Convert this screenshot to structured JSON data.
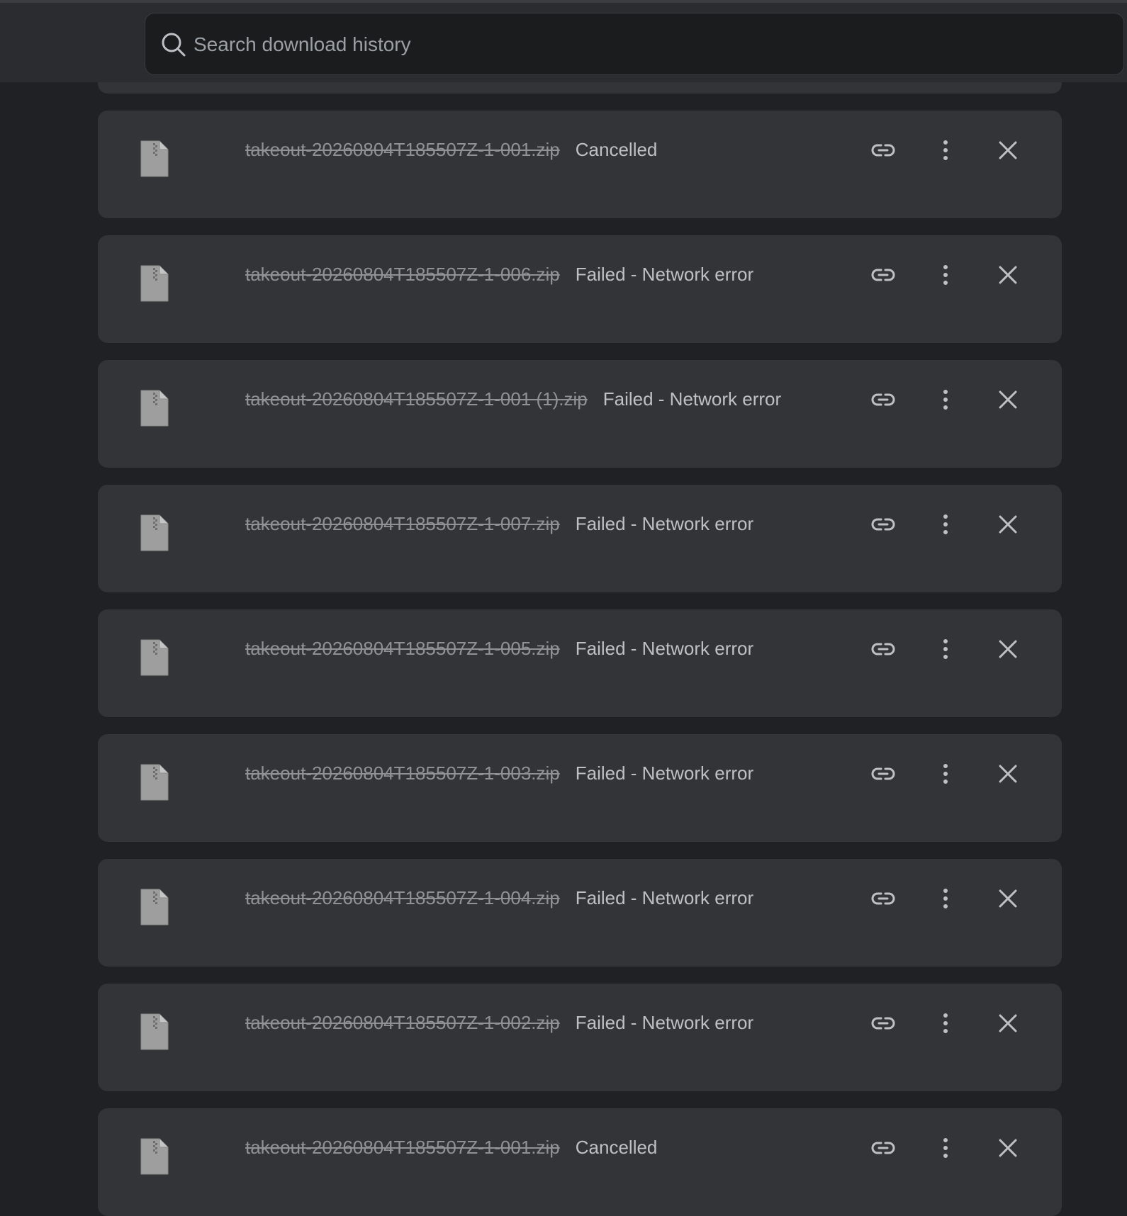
{
  "search": {
    "placeholder": "Search download history",
    "value": ""
  },
  "icons": {
    "search": "search-icon",
    "file": "zip-file-icon",
    "copy_link": "link-icon",
    "more": "more-vert-icon",
    "remove": "close-icon"
  },
  "colors": {
    "background": "#202124",
    "card": "#333437",
    "filename": "#8e9297",
    "status": "#bdc1c6"
  },
  "downloads": [
    {
      "filename": "takeout-20260804T185507Z-1-001.zip",
      "status": "Cancelled"
    },
    {
      "filename": "takeout-20260804T185507Z-1-006.zip",
      "status": "Failed - Network error"
    },
    {
      "filename": "takeout-20260804T185507Z-1-001 (1).zip",
      "status": "Failed - Network error"
    },
    {
      "filename": "takeout-20260804T185507Z-1-007.zip",
      "status": "Failed - Network error"
    },
    {
      "filename": "takeout-20260804T185507Z-1-005.zip",
      "status": "Failed - Network error"
    },
    {
      "filename": "takeout-20260804T185507Z-1-003.zip",
      "status": "Failed - Network error"
    },
    {
      "filename": "takeout-20260804T185507Z-1-004.zip",
      "status": "Failed - Network error"
    },
    {
      "filename": "takeout-20260804T185507Z-1-002.zip",
      "status": "Failed - Network error"
    },
    {
      "filename": "takeout-20260804T185507Z-1-001.zip",
      "status": "Cancelled"
    }
  ]
}
